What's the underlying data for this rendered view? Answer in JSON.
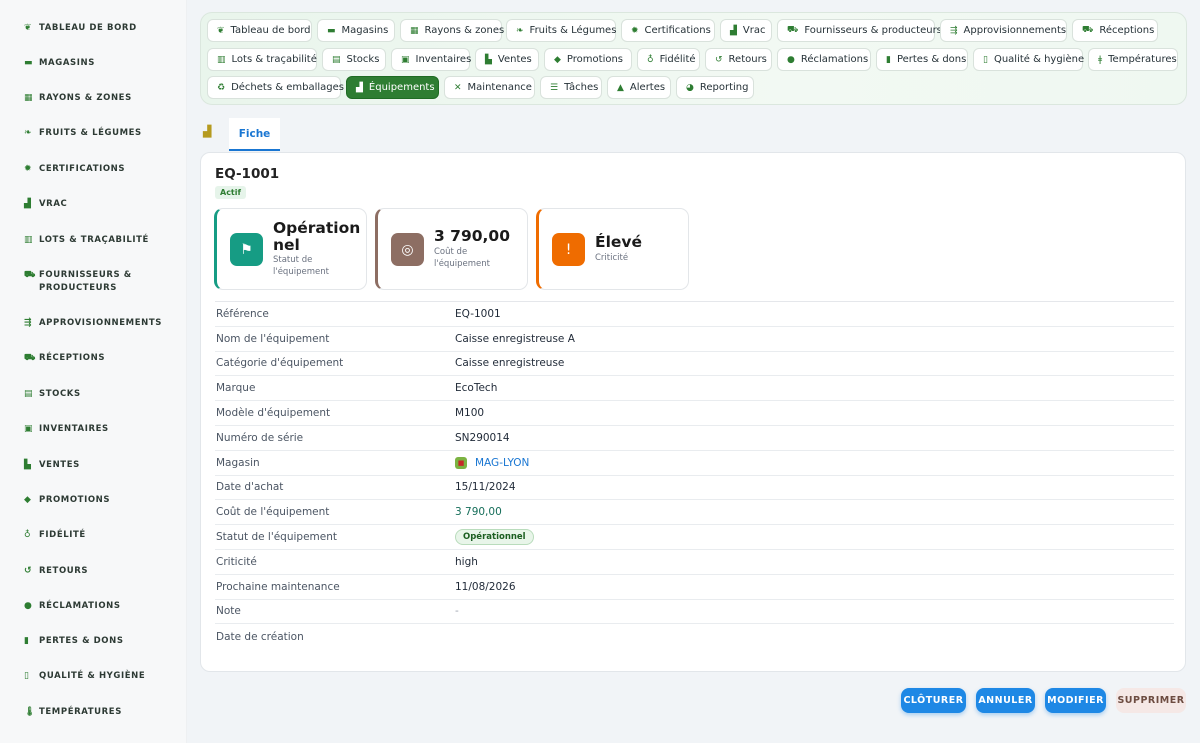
{
  "sidebar": {
    "items": [
      {
        "label": "Tableau de bord",
        "icon": "sprout-icon"
      },
      {
        "label": "Magasins",
        "icon": "store-icon"
      },
      {
        "label": "Rayons & zones",
        "icon": "grid-icon"
      },
      {
        "label": "Fruits & Légumes",
        "icon": "leaf-icon"
      },
      {
        "label": "Certifications",
        "icon": "certificate-icon"
      },
      {
        "label": "Vrac",
        "icon": "bulk-icon"
      },
      {
        "label": "Lots & traçabilité",
        "icon": "barcode-icon"
      },
      {
        "label": "Fournisseurs & producteurs",
        "icon": "tractor-icon"
      },
      {
        "label": "Approvisionnements",
        "icon": "supply-icon"
      },
      {
        "label": "Réceptions",
        "icon": "truck-icon"
      },
      {
        "label": "Stocks",
        "icon": "warehouse-icon"
      },
      {
        "label": "Inventaires",
        "icon": "clipboard-check-icon"
      },
      {
        "label": "Ventes",
        "icon": "cash-register-icon"
      },
      {
        "label": "Promotions",
        "icon": "tag-icon"
      },
      {
        "label": "Fidélité",
        "icon": "award-icon"
      },
      {
        "label": "Retours",
        "icon": "undo-icon"
      },
      {
        "label": "Réclamations",
        "icon": "comment-icon"
      },
      {
        "label": "Pertes & dons",
        "icon": "trash-icon"
      },
      {
        "label": "Qualité & hygiène",
        "icon": "clipboard-icon"
      },
      {
        "label": "Températures",
        "icon": "thermometer-icon"
      }
    ]
  },
  "chips": [
    {
      "label": "Tableau de bord",
      "icon": "sprout-icon"
    },
    {
      "label": "Magasins",
      "icon": "store-icon"
    },
    {
      "label": "Rayons & zones",
      "icon": "grid-icon"
    },
    {
      "label": "Fruits & Légumes",
      "icon": "leaf-icon"
    },
    {
      "label": "Certifications",
      "icon": "certificate-icon"
    },
    {
      "label": "Vrac",
      "icon": "bulk-icon"
    },
    {
      "label": "Fournisseurs & producteurs",
      "icon": "tractor-icon"
    },
    {
      "label": "Approvisionnements",
      "icon": "supply-icon"
    },
    {
      "label": "Réceptions",
      "icon": "truck-icon"
    },
    {
      "label": "Lots & traçabilité",
      "icon": "barcode-icon"
    },
    {
      "label": "Stocks",
      "icon": "warehouse-icon"
    },
    {
      "label": "Inventaires",
      "icon": "clipboard-check-icon"
    },
    {
      "label": "Ventes",
      "icon": "cash-register-icon"
    },
    {
      "label": "Promotions",
      "icon": "tag-icon"
    },
    {
      "label": "Fidélité",
      "icon": "award-icon"
    },
    {
      "label": "Retours",
      "icon": "undo-icon"
    },
    {
      "label": "Réclamations",
      "icon": "comment-icon"
    },
    {
      "label": "Pertes & dons",
      "icon": "trash-icon"
    },
    {
      "label": "Qualité & hygiène",
      "icon": "clipboard-icon"
    },
    {
      "label": "Températures",
      "icon": "thermometer-icon"
    },
    {
      "label": "Déchets & emballages",
      "icon": "recycle-icon"
    },
    {
      "label": "Équipements",
      "icon": "equipment-icon",
      "active": true
    },
    {
      "label": "Maintenance",
      "icon": "tools-icon"
    },
    {
      "label": "Tâches",
      "icon": "list-check-icon"
    },
    {
      "label": "Alertes",
      "icon": "bell-icon"
    },
    {
      "label": "Reporting",
      "icon": "pie-chart-icon"
    }
  ],
  "tabs": {
    "active": "Fiche"
  },
  "record": {
    "id": "EQ-1001",
    "status_badge": "Actif"
  },
  "kpis": [
    {
      "value": "Opération nel",
      "label": "Statut de l'équipement",
      "icon": "flag-icon",
      "color": "#169c84"
    },
    {
      "value": "3 790,00",
      "label": "Coût de l'équipement",
      "icon": "coins-icon",
      "color": "#8d6e63"
    },
    {
      "value": "Élevé",
      "label": "Criticité",
      "icon": "alert-icon",
      "color": "#ef6c00"
    }
  ],
  "details": {
    "reference": {
      "label": "Référence",
      "value": "EQ-1001"
    },
    "nom": {
      "label": "Nom de l'équipement",
      "value": "Caisse enregistreuse A"
    },
    "categorie": {
      "label": "Catégorie d'équipement",
      "value": "Caisse enregistreuse"
    },
    "marque": {
      "label": "Marque",
      "value": "EcoTech"
    },
    "modele": {
      "label": "Modèle d'équipement",
      "value": "M100"
    },
    "serie": {
      "label": "Numéro de série",
      "value": "SN290014"
    },
    "magasin": {
      "label": "Magasin",
      "value": "MAG-LYON"
    },
    "date_achat": {
      "label": "Date d'achat",
      "value": "15/11/2024"
    },
    "cout": {
      "label": "Coût de l'équipement",
      "value": "3 790,00"
    },
    "statut": {
      "label": "Statut de l'équipement",
      "value": "Opérationnel"
    },
    "criticite": {
      "label": "Criticité",
      "value": "high"
    },
    "maintenance": {
      "label": "Prochaine maintenance",
      "value": "11/08/2026"
    },
    "note": {
      "label": "Note",
      "value": "-"
    },
    "date_creation": {
      "label": "Date de création",
      "value": ""
    }
  },
  "actions": {
    "cloturer": "Clôturer",
    "annuler": "Annuler",
    "modifier": "Modifier",
    "supprimer": "Supprimer"
  },
  "colors": {
    "brand_green": "#2e7d32",
    "action_blue": "#1e88e5",
    "link_blue": "#1976d2"
  }
}
